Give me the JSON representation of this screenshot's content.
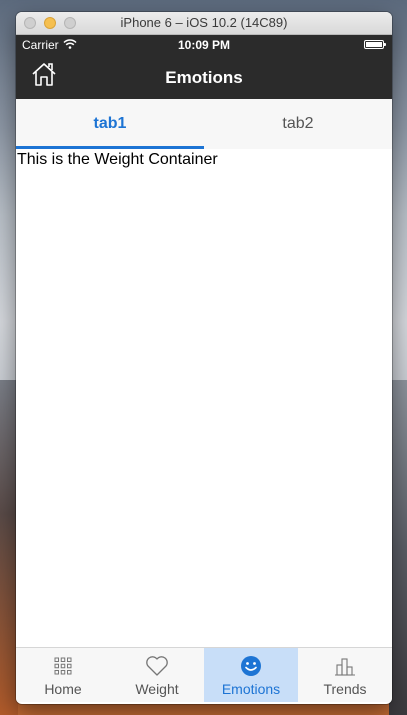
{
  "window": {
    "title": "iPhone 6 – iOS 10.2 (14C89)"
  },
  "status_bar": {
    "carrier": "Carrier",
    "time": "10:09 PM"
  },
  "nav": {
    "title": "Emotions",
    "home_icon": "home-icon"
  },
  "tabs": [
    {
      "label": "tab1",
      "active": true
    },
    {
      "label": "tab2",
      "active": false
    }
  ],
  "content": {
    "text": "This is the Weight Container"
  },
  "tab_bar": {
    "items": [
      {
        "label": "Home",
        "icon": "grid-icon",
        "active": false
      },
      {
        "label": "Weight",
        "icon": "heart-icon",
        "active": false
      },
      {
        "label": "Emotions",
        "icon": "smiley-icon",
        "active": true
      },
      {
        "label": "Trends",
        "icon": "bar-chart-icon",
        "active": false
      }
    ]
  },
  "colors": {
    "accent": "#1d74d4",
    "nav_background": "#2b2b2b",
    "active_tab_background": "#c8def8"
  }
}
